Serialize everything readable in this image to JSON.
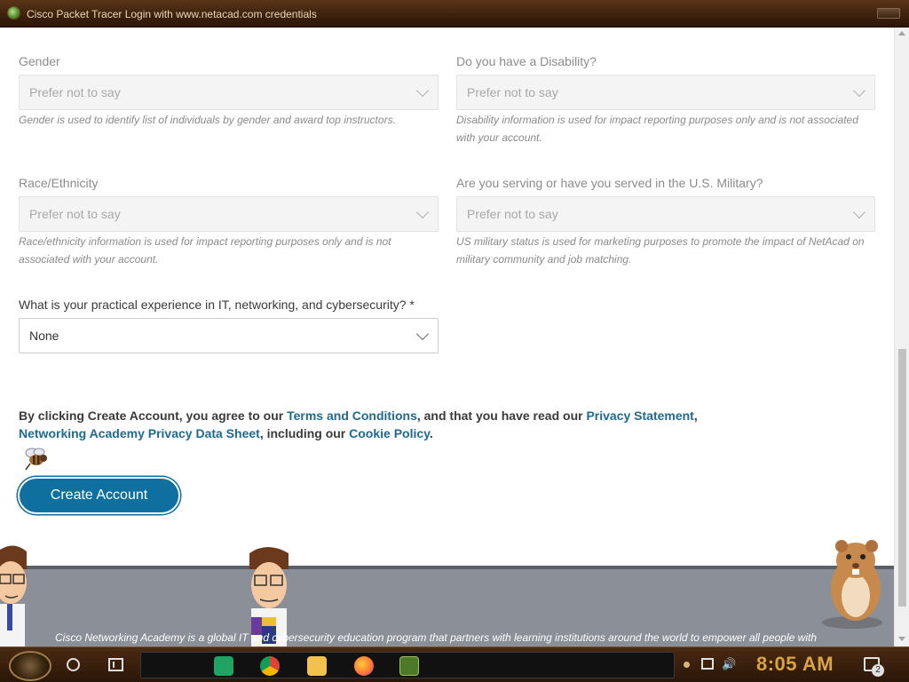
{
  "window": {
    "title": "Cisco Packet Tracer Login with www.netacad.com credentials"
  },
  "form": {
    "gender": {
      "label": "Gender",
      "value": "Prefer not to say",
      "hint": "Gender is used to identify list of individuals by gender and award top instructors."
    },
    "disability": {
      "label": "Do you have a Disability?",
      "value": "Prefer not to say",
      "hint_line1": "Disability information is used for impact reporting purposes only and is not associated",
      "hint_line2": "with your account."
    },
    "race": {
      "label": "Race/Ethnicity",
      "value": "Prefer not to say",
      "hint_line1": "Race/ethnicity information is used for impact reporting purposes only and is not",
      "hint_line2": "associated with your account."
    },
    "military": {
      "label": "Are you serving or have you served in the U.S. Military?",
      "value": "Prefer not to say",
      "hint_line1": "US military status is used for marketing purposes to promote the impact of NetAcad on",
      "hint_line2": "military community and job matching."
    },
    "experience": {
      "label": "What is your practical experience in IT, networking, and cybersecurity? *",
      "value": "None"
    }
  },
  "consent": {
    "prefix": "By clicking Create Account, you agree to our ",
    "terms_link": "Terms and Conditions",
    "middle": ", and that you have read our ",
    "privacy_link": "Privacy Statement",
    "comma": ",",
    "datasheet_link": "Networking Academy Privacy Data Sheet",
    "including": ", including our ",
    "cookie_link": "Cookie Policy",
    "end": "."
  },
  "actions": {
    "create_account": "Create Account"
  },
  "footer": {
    "text": "Cisco Networking Academy is a global IT and cybersecurity education program that partners with learning institutions around the world to empower all people with"
  },
  "taskbar": {
    "time": "8:05 AM",
    "notification_count": "2",
    "apps": [
      "sheets-icon",
      "chrome-icon",
      "file-explorer-icon",
      "firefox-icon",
      "packet-tracer-icon"
    ]
  },
  "colors": {
    "link": "#1d6a94",
    "button": "#0f6f9f",
    "clock": "#d9a441"
  }
}
